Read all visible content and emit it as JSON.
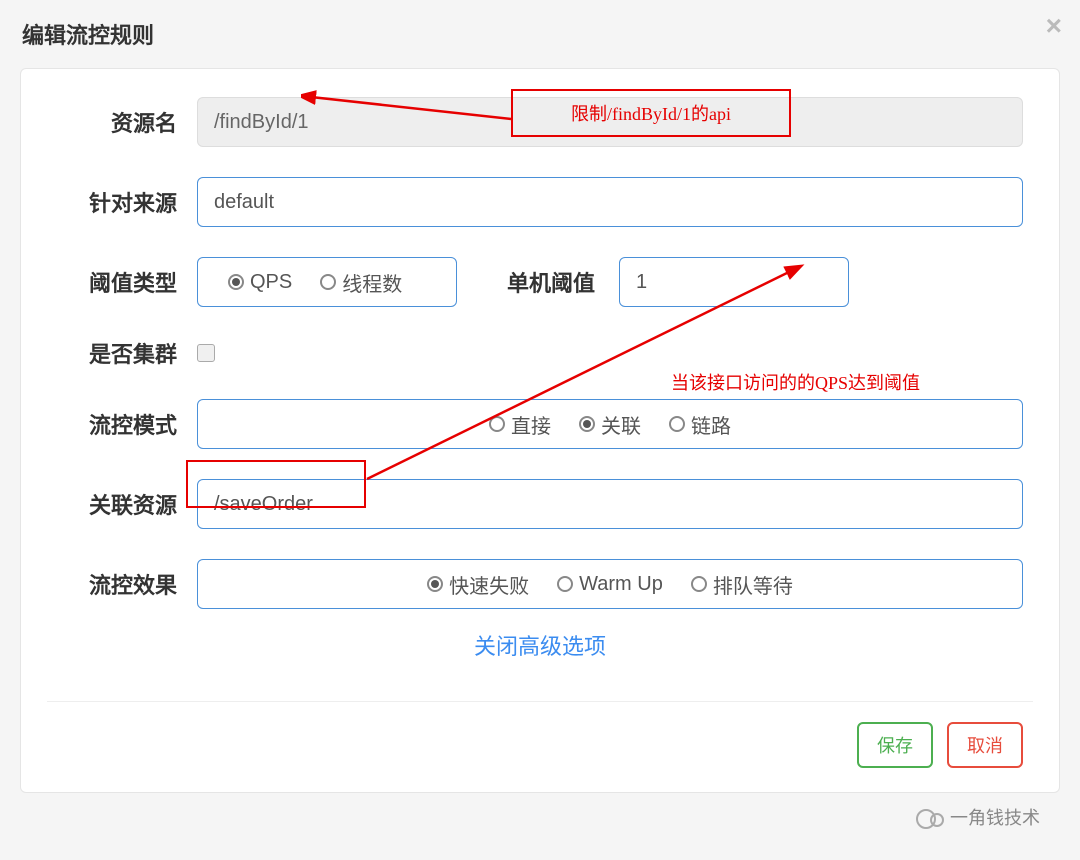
{
  "modal": {
    "title": "编辑流控规则",
    "close": "×"
  },
  "form": {
    "resource": {
      "label": "资源名",
      "value": "/findById/1"
    },
    "source": {
      "label": "针对来源",
      "value": "default"
    },
    "thresholdType": {
      "label": "阈值类型",
      "options": {
        "qps": "QPS",
        "thread": "线程数"
      },
      "selected": "qps"
    },
    "thresholdValue": {
      "label": "单机阈值",
      "value": "1"
    },
    "cluster": {
      "label": "是否集群",
      "checked": false
    },
    "mode": {
      "label": "流控模式",
      "options": {
        "direct": "直接",
        "assoc": "关联",
        "chain": "链路"
      },
      "selected": "assoc"
    },
    "relatedResource": {
      "label": "关联资源",
      "value": "/saveOrder"
    },
    "effect": {
      "label": "流控效果",
      "options": {
        "fail": "快速失败",
        "warmup": "Warm Up",
        "queue": "排队等待"
      },
      "selected": "fail"
    }
  },
  "link": "关闭高级选项",
  "buttons": {
    "save": "保存",
    "cancel": "取消"
  },
  "annotations": {
    "box1_text": "限制/findById/1的api",
    "text2": "当该接口访问的的QPS达到阈值"
  },
  "watermark": "一角钱技术"
}
